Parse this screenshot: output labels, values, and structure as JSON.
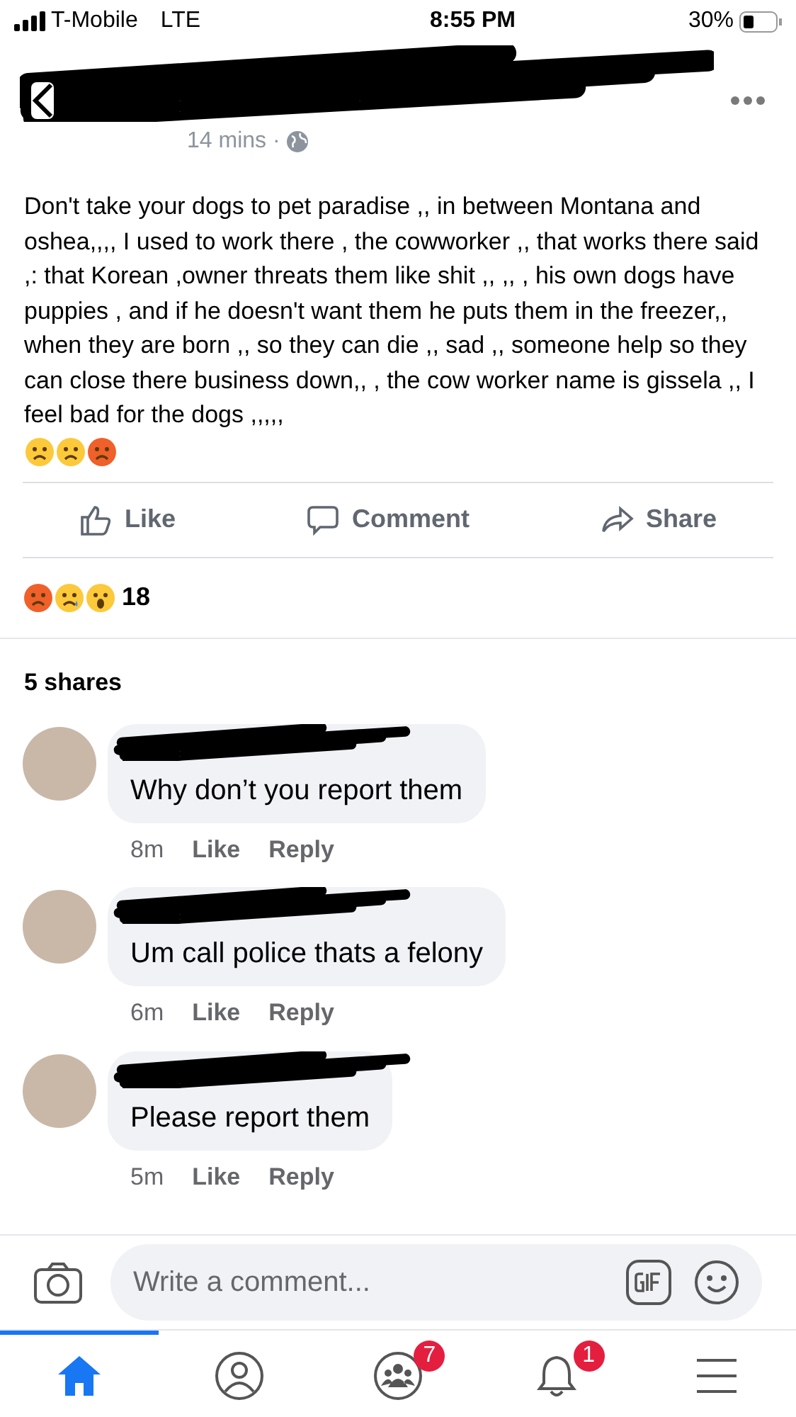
{
  "status_bar": {
    "carrier": "T-Mobile",
    "network": "LTE",
    "time": "8:55 PM",
    "battery": "30%"
  },
  "post": {
    "time": "14 mins ·",
    "text": "Don't take your dogs to pet paradise ,, in between Montana and oshea,,,, I used to work there , the cowworker ,, that works there said ,: that  Korean ,owner threats them like shit ,, ,, , his own dogs have puppies , and if he doesn't want them he puts them in the freezer,, when they are born ,, so they can die ,, sad ,, someone help so they can close there business down,, , the cow worker name is gissela ,, I feel bad for the dogs ,,,,,"
  },
  "actions": [
    "Like",
    "Comment",
    "Share"
  ],
  "reactions": {
    "count": "18"
  },
  "shares": "5 shares",
  "comments": [
    {
      "text": "Why don’t you report them",
      "time": "8m",
      "like": "Like",
      "reply": "Reply"
    },
    {
      "text": "Um call police thats a felony",
      "time": "6m",
      "like": "Like",
      "reply": "Reply"
    },
    {
      "text": "Please report them",
      "time": "5m",
      "like": "Like",
      "reply": "Reply"
    }
  ],
  "composer": {
    "placeholder": "Write a comment..."
  },
  "nav": [
    {
      "kind": "home",
      "selected": true
    },
    {
      "kind": "profile",
      "selected": false
    },
    {
      "kind": "groups",
      "selected": false,
      "badge": "7"
    },
    {
      "kind": "bell",
      "selected": false,
      "badge": "1"
    },
    {
      "kind": "menu",
      "selected": false
    }
  ]
}
